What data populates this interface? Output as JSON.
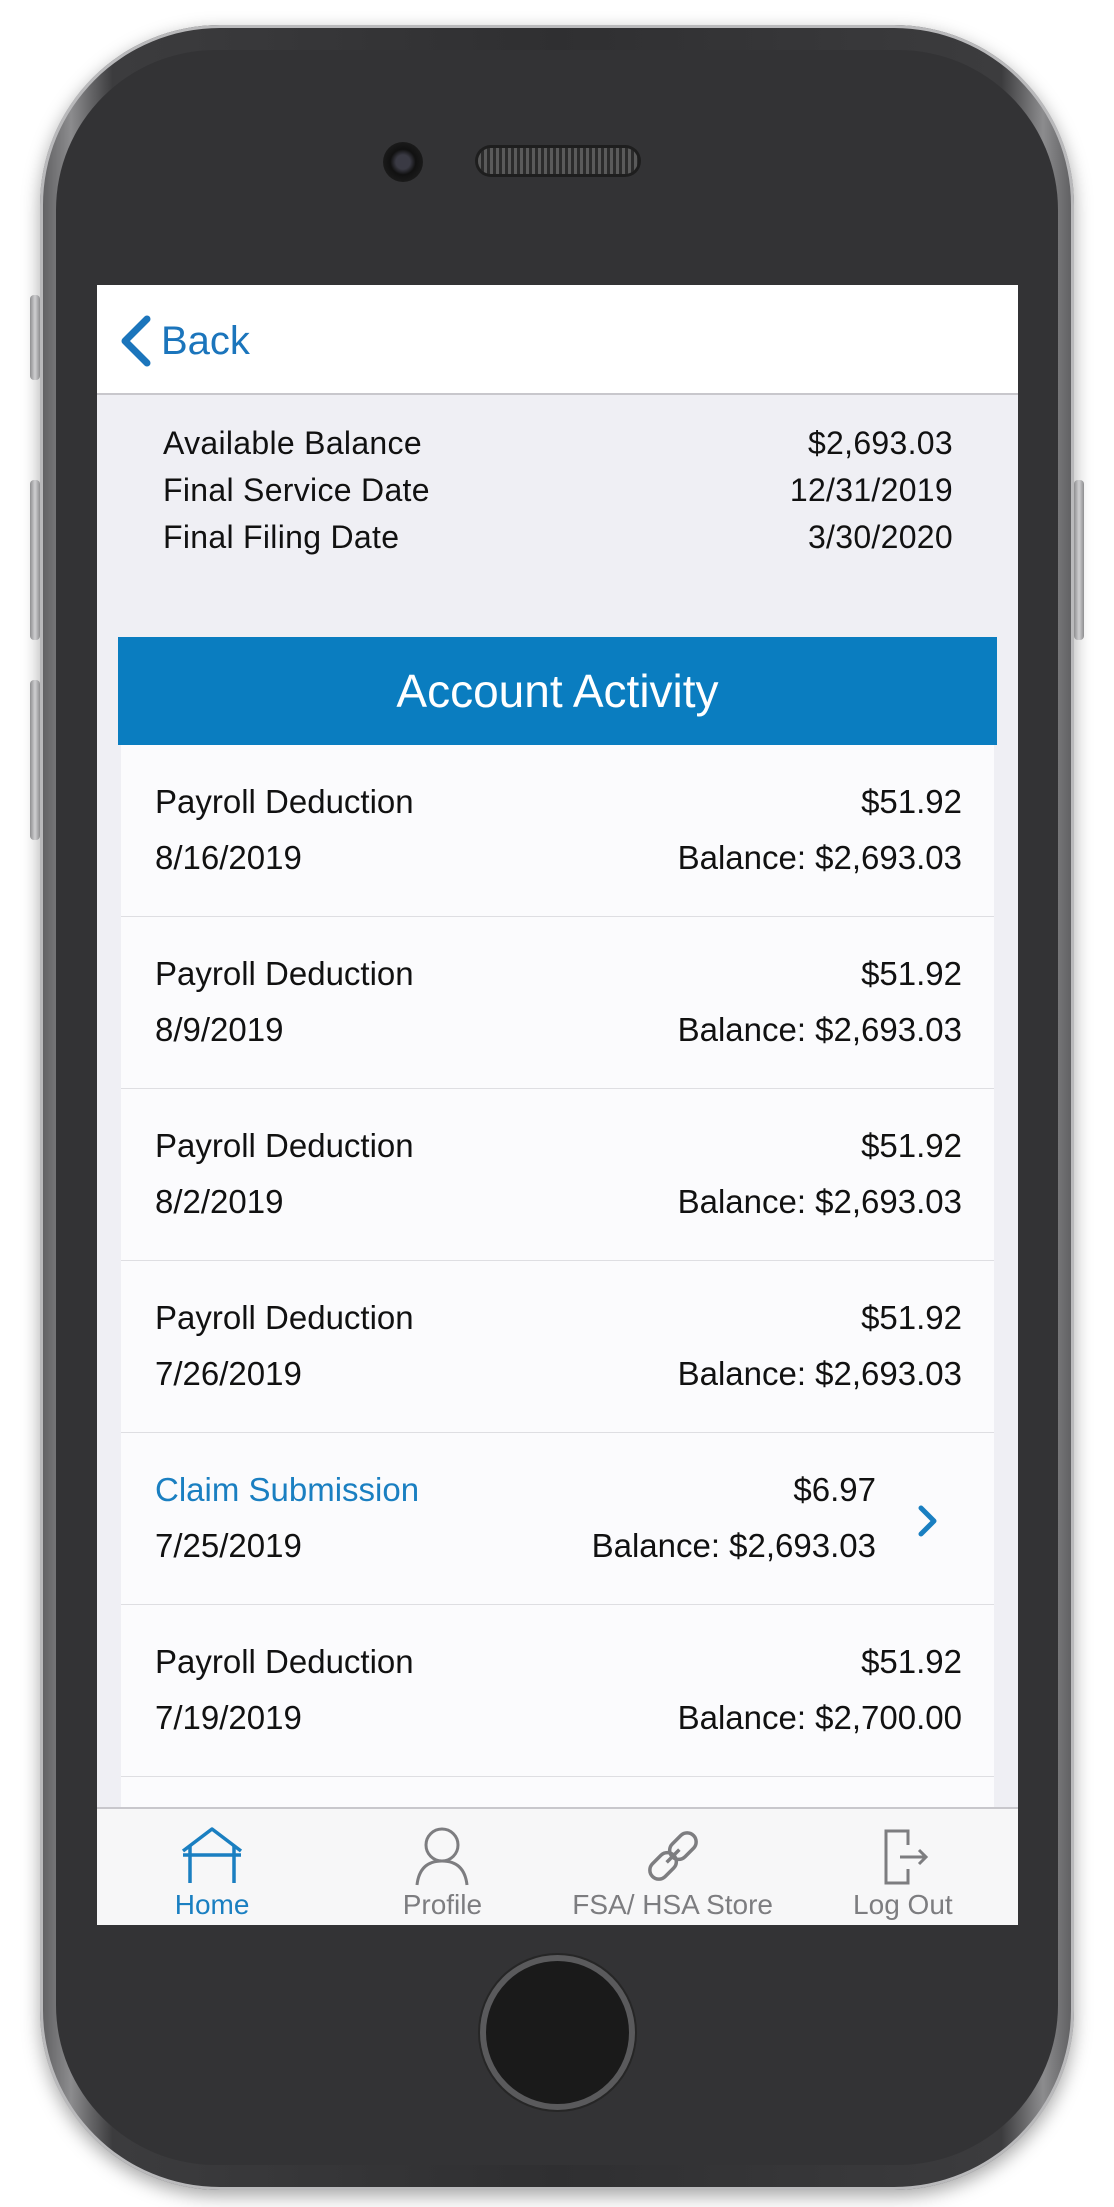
{
  "nav": {
    "back_label": "Back"
  },
  "summary": [
    {
      "label": "Available Balance",
      "value": "$2,693.03"
    },
    {
      "label": "Final Service Date",
      "value": "12/31/2019"
    },
    {
      "label": "Final Filing Date",
      "value": "3/30/2020"
    }
  ],
  "activity": {
    "header": "Account Activity",
    "items": [
      {
        "title": "Payroll Deduction",
        "date": "8/16/2019",
        "amount": "$51.92",
        "balance": "Balance: $2,693.03"
      },
      {
        "title": "Payroll Deduction",
        "date": "8/9/2019",
        "amount": "$51.92",
        "balance": "Balance: $2,693.03"
      },
      {
        "title": "Payroll Deduction",
        "date": "8/2/2019",
        "amount": "$51.92",
        "balance": "Balance: $2,693.03"
      },
      {
        "title": "Payroll Deduction",
        "date": "7/26/2019",
        "amount": "$51.92",
        "balance": "Balance: $2,693.03"
      },
      {
        "title": "Claim Submission",
        "date": "7/25/2019",
        "amount": "$6.97",
        "balance": "Balance: $2,693.03",
        "is_link": true,
        "icon": "chevron-right-icon"
      },
      {
        "title": "Payroll Deduction",
        "date": "7/19/2019",
        "amount": "$51.92",
        "balance": "Balance: $2,700.00"
      }
    ]
  },
  "tabbar": {
    "tabs": [
      {
        "label": "Home",
        "icon": "home-icon",
        "active": true
      },
      {
        "label": "Profile",
        "icon": "profile-icon",
        "active": false
      },
      {
        "label": "FSA/ HSA Store",
        "icon": "link-icon",
        "active": false
      },
      {
        "label": "Log Out",
        "icon": "logout-icon",
        "active": false
      }
    ]
  },
  "colors": {
    "accent": "#1a7fc1",
    "header_bg": "#0a7dc0",
    "screen_bg": "#efeff4",
    "inactive_tab": "#7d7d80"
  }
}
